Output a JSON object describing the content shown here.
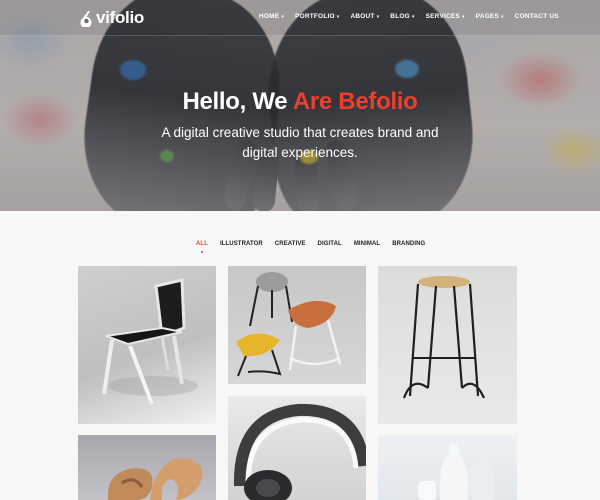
{
  "brand": {
    "name": "vifolio"
  },
  "nav": {
    "items": [
      {
        "label": "HOME",
        "has_dropdown": true
      },
      {
        "label": "PORTFOLIO",
        "has_dropdown": true
      },
      {
        "label": "ABOUT",
        "has_dropdown": true
      },
      {
        "label": "BLOG",
        "has_dropdown": true
      },
      {
        "label": "SERVICES",
        "has_dropdown": true
      },
      {
        "label": "PAGES",
        "has_dropdown": true
      },
      {
        "label": "CONTACT US",
        "has_dropdown": false
      }
    ]
  },
  "hero": {
    "title_prefix": "Hello, We ",
    "title_accent": "Are Befolio",
    "subtitle": "A digital creative studio that creates brand and digital experiences."
  },
  "portfolio": {
    "filters": [
      "ALL",
      "ILLUSTRATOR",
      "CREATIVE",
      "DIGITAL",
      "MINIMAL",
      "BRANDING"
    ],
    "active_filter": "ALL",
    "items": [
      {
        "subject": "black chair"
      },
      {
        "subject": "yellow and orange stools"
      },
      {
        "subject": "bar stool"
      },
      {
        "subject": "wooden knot sculpture"
      },
      {
        "subject": "headphones"
      },
      {
        "subject": "white vases"
      }
    ]
  },
  "colors": {
    "accent": "#ec3f2e",
    "text_dark": "#222222",
    "page_bg": "#f7f7f7"
  },
  "icons": {
    "logo": "vifolio-logo-icon",
    "dropdown": "chevron-down-icon"
  }
}
